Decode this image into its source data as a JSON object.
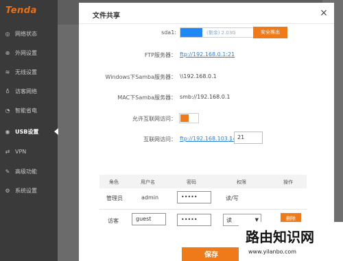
{
  "sidebar": {
    "logo": "Tenda",
    "items": [
      {
        "label": "网络状态",
        "icon": "status-icon"
      },
      {
        "label": "外网设置",
        "icon": "globe-icon"
      },
      {
        "label": "无线设置",
        "icon": "wifi-icon"
      },
      {
        "label": "访客网络",
        "icon": "guest-icon"
      },
      {
        "label": "智能省电",
        "icon": "power-save-icon"
      },
      {
        "label": "USB设置",
        "icon": "usb-icon",
        "active": true
      },
      {
        "label": "VPN",
        "icon": "vpn-icon"
      },
      {
        "label": "高级功能",
        "icon": "advanced-icon"
      },
      {
        "label": "系统设置",
        "icon": "settings-icon"
      }
    ]
  },
  "modal": {
    "title": "文件共享",
    "close": "×",
    "disk": {
      "label": "sda1:",
      "usage_text": "(剩余) 2.03G",
      "used_fraction": 0.28,
      "eject_label": "安全推出"
    },
    "ftp": {
      "label": "FTP服务器：",
      "value": "ftp://192.168.0.1:21"
    },
    "samba": {
      "label": "Windows下Samba服务器：",
      "value": "\\\\192.168.0.1"
    },
    "mac_samba": {
      "label": "MAC下Samba服务器：",
      "value": "smb://192.168.0.1"
    },
    "allow_internet": {
      "label": "允许互联网访问：",
      "enabled": true
    },
    "internet_access": {
      "label": "互联网访问：",
      "value": "ftp://192.168.103.143",
      "sep": ":",
      "port": "21"
    },
    "table": {
      "headers": [
        "角色",
        "用户名",
        "密码",
        "权限",
        "操作"
      ],
      "rows": [
        {
          "role": "管理员",
          "username": "admin",
          "password": "•••••",
          "permission": "读/写"
        },
        {
          "role": "访客",
          "username": "guest",
          "password": "•••••",
          "permission": "读",
          "action": "删除"
        }
      ]
    },
    "save": "保存"
  },
  "watermark": {
    "title": "路由知识网",
    "url": "www.yilanbo.com"
  },
  "colors": {
    "accent": "#ef7a1a",
    "link": "#2a7fd6",
    "usage_fill": "#1e88f5",
    "sidebar_bg": "#3a3a3a"
  }
}
